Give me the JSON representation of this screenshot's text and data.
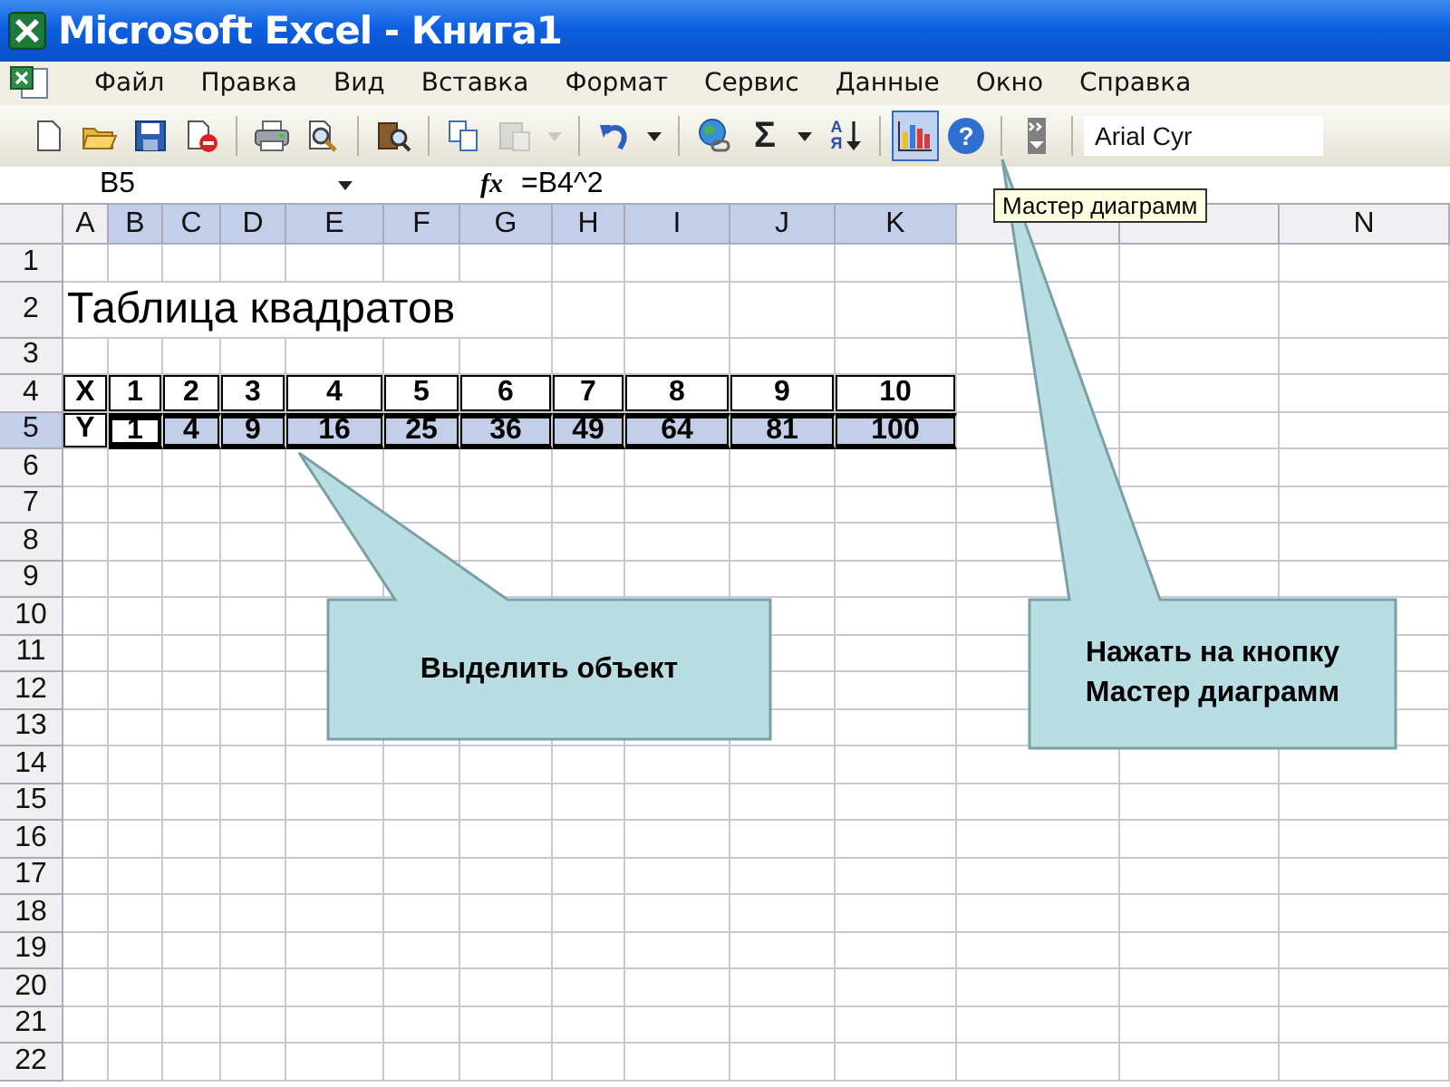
{
  "window": {
    "title": "Microsoft Excel - Книга1"
  },
  "menu": [
    {
      "label": "Файл"
    },
    {
      "label": "Правка"
    },
    {
      "label": "Вид"
    },
    {
      "label": "Вставка"
    },
    {
      "label": "Формат"
    },
    {
      "label": "Сервис"
    },
    {
      "label": "Данные"
    },
    {
      "label": "Окно"
    },
    {
      "label": "Справка"
    }
  ],
  "toolbar": {
    "groups": [
      [
        {
          "kind": "new",
          "pressed": false,
          "disabled": false
        },
        {
          "kind": "open",
          "pressed": false,
          "disabled": false
        },
        {
          "kind": "save",
          "pressed": false,
          "disabled": false
        },
        {
          "kind": "permission",
          "pressed": false,
          "disabled": false
        }
      ],
      [
        {
          "kind": "print",
          "pressed": false,
          "disabled": false
        },
        {
          "kind": "preview",
          "pressed": false,
          "disabled": false
        }
      ],
      [
        {
          "kind": "research",
          "pressed": false,
          "disabled": false
        }
      ],
      [
        {
          "kind": "copy",
          "pressed": false,
          "disabled": false
        },
        {
          "kind": "paste",
          "pressed": false,
          "disabled": true
        },
        {
          "kind": "dropdown",
          "pressed": false,
          "disabled": true
        }
      ],
      [
        {
          "kind": "undo",
          "pressed": false,
          "disabled": false
        },
        {
          "kind": "dropdown",
          "pressed": false,
          "disabled": false
        }
      ],
      [
        {
          "kind": "hyperlink",
          "pressed": false,
          "disabled": false
        },
        {
          "kind": "sum",
          "label": "Σ",
          "pressed": false,
          "disabled": false
        },
        {
          "kind": "dropdown",
          "pressed": false,
          "disabled": false
        },
        {
          "kind": "sort",
          "label": "АЯ",
          "pressed": false,
          "disabled": false
        }
      ],
      [
        {
          "kind": "chart",
          "pressed": true,
          "disabled": false
        },
        {
          "kind": "help",
          "label": "?",
          "pressed": false,
          "disabled": false
        }
      ],
      [
        {
          "kind": "options",
          "pressed": false,
          "disabled": false
        }
      ]
    ],
    "font": "Arial Cyr"
  },
  "formula_bar": {
    "name_box": "B5",
    "fx": "fx",
    "formula": "=B4^2"
  },
  "tooltip": "Мастер диаграмм",
  "columns": [
    {
      "label": "A",
      "selected": false
    },
    {
      "label": "B",
      "selected": true
    },
    {
      "label": "C",
      "selected": true
    },
    {
      "label": "D",
      "selected": true
    },
    {
      "label": "E",
      "selected": true
    },
    {
      "label": "F",
      "selected": true
    },
    {
      "label": "G",
      "selected": true
    },
    {
      "label": "H",
      "selected": true
    },
    {
      "label": "I",
      "selected": true
    },
    {
      "label": "J",
      "selected": true
    },
    {
      "label": "K",
      "selected": true
    },
    {
      "selected": false
    },
    {
      "selected": false
    },
    {
      "label": "N",
      "selected": false
    }
  ],
  "rows": [
    {
      "header": "1",
      "selected": false,
      "cells": []
    },
    {
      "header": "2",
      "selected": false,
      "framed": false,
      "cells": [
        {
          "text": "Таблица квадратов",
          "kind": "title",
          "selected": false
        }
      ]
    },
    {
      "header": "3",
      "selected": false,
      "cells": []
    },
    {
      "header": "4",
      "selected": false,
      "framed": true,
      "cells": [
        {
          "text": "X",
          "kind": "value",
          "selected": false
        },
        {
          "text": "1",
          "kind": "value",
          "selected": false
        },
        {
          "text": "2",
          "kind": "value",
          "selected": false
        },
        {
          "text": "3",
          "kind": "value",
          "selected": false
        },
        {
          "text": "4",
          "kind": "value",
          "selected": false
        },
        {
          "text": "5",
          "kind": "value",
          "selected": false
        },
        {
          "text": "6",
          "kind": "value",
          "selected": false
        },
        {
          "text": "7",
          "kind": "value",
          "selected": false
        },
        {
          "text": "8",
          "kind": "value",
          "selected": false
        },
        {
          "text": "9",
          "kind": "value",
          "selected": false
        },
        {
          "text": "10",
          "kind": "value",
          "selected": false
        }
      ]
    },
    {
      "header": "5",
      "selected": true,
      "framed": true,
      "cells": [
        {
          "text": "Y",
          "kind": "value",
          "selected": false
        },
        {
          "text": "1",
          "kind": "value",
          "selected": true
        },
        {
          "text": "4",
          "kind": "value",
          "selected": true
        },
        {
          "text": "9",
          "kind": "value",
          "selected": true
        },
        {
          "text": "16",
          "kind": "value",
          "selected": true
        },
        {
          "text": "25",
          "kind": "value",
          "selected": true
        },
        {
          "text": "36",
          "kind": "value",
          "selected": true
        },
        {
          "text": "49",
          "kind": "value",
          "selected": true
        },
        {
          "text": "64",
          "kind": "value",
          "selected": true
        },
        {
          "text": "81",
          "kind": "value",
          "selected": true
        },
        {
          "text": "100",
          "kind": "value",
          "selected": true
        }
      ]
    },
    {
      "header": "6",
      "selected": false,
      "cells": []
    },
    {
      "header": "7",
      "selected": false,
      "cells": []
    },
    {
      "header": "8",
      "selected": false,
      "cells": []
    },
    {
      "header": "9",
      "selected": false,
      "cells": []
    },
    {
      "header": "10",
      "selected": false,
      "cells": []
    },
    {
      "header": "11",
      "selected": false,
      "cells": []
    },
    {
      "header": "12",
      "selected": false,
      "cells": []
    },
    {
      "header": "13",
      "selected": false,
      "cells": []
    },
    {
      "header": "14",
      "selected": false,
      "cells": []
    },
    {
      "header": "15",
      "selected": false,
      "cells": []
    },
    {
      "header": "16",
      "selected": false,
      "cells": []
    },
    {
      "header": "17",
      "selected": false,
      "cells": []
    },
    {
      "header": "18",
      "selected": false,
      "cells": []
    },
    {
      "header": "19",
      "selected": false,
      "cells": []
    },
    {
      "header": "20",
      "selected": false,
      "cells": []
    },
    {
      "header": "21",
      "selected": false,
      "cells": []
    },
    {
      "header": "22",
      "selected": false,
      "cells": []
    }
  ],
  "callouts": [
    {
      "text": "Выделить объект"
    },
    {
      "text": "Нажать на кнопку\nМастер диаграмм"
    }
  ]
}
